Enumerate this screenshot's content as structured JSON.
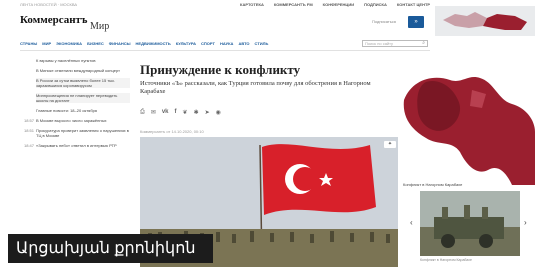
{
  "topbar": {
    "left_text": "ЛЕНТА НОВОСТЕЙ · МОСКВА",
    "links": [
      "КАРТОТЕКА",
      "КОММЕРСАНТЪ FM",
      "КОНФЕРЕНЦИИ",
      "ПОДПИСКА",
      "КОНТАКТ ЦЕНТР"
    ]
  },
  "brand": {
    "name": "Коммерсантъ",
    "section": "Мир"
  },
  "subscribe": {
    "label": "Подписаться",
    "button": "»"
  },
  "nav": {
    "items": [
      "СТРАНЫ",
      "МИР",
      "ЭКОНОМИКА",
      "БИЗНЕС",
      "ФИНАНСЫ",
      "НЕДВИЖИМОСТЬ",
      "КУЛЬТУРА",
      "СПОРТ",
      "НАУКА",
      "АВТО",
      "СТИЛЬ"
    ],
    "search_placeholder": "Поиск по сайту",
    "search_icon": "search-icon"
  },
  "sidebar": {
    "items": [
      {
        "time": "",
        "text": "К взрывы у населённых пунктов",
        "highlight": false
      },
      {
        "time": "",
        "text": "В Минске отменили международный концерт",
        "highlight": false
      },
      {
        "time": "",
        "text": "В России за сутки выявлено более 15 тыс. заразившихся коронавирусом",
        "highlight": true
      },
      {
        "time": "",
        "text": "Минпросвещения не планирует переводить школы на дистант",
        "highlight": true
      },
      {
        "time": "",
        "text": "Главные новости: 18–20 октября",
        "highlight": false
      },
      {
        "time": "18:57",
        "text": "В Москве выросло число заражённых",
        "highlight": false
      },
      {
        "time": "18:51",
        "text": "Прокуратура проверит заявления о нарушениях в ТЦ в Москве",
        "highlight": false
      },
      {
        "time": "18:47",
        "text": "«Закрывать небо» ответил в интервью РТР",
        "highlight": false
      }
    ]
  },
  "article": {
    "headline": "Принуждение к конфликту",
    "subhead": "Источники «Ъ» рассказали, как Турция готовила почву для обострения в Нагорном Карабахе",
    "share_icons": [
      "print-icon",
      "comments-icon",
      "vk-icon",
      "facebook-icon",
      "twitter-icon",
      "ok-icon",
      "telegram-icon",
      "whatsapp-icon"
    ],
    "meta": "Коммерсантъ от 14.10.2020, 00:10",
    "photo_badge": "✦"
  },
  "right_panel": {
    "map_caption": "Конфликт в Нагорном Карабахе",
    "photo_caption": "Конфликт в Нагорном Карабахе"
  },
  "overlay": {
    "text": "Արցախյան քրոնիկոն"
  },
  "colors": {
    "accent": "#1a5a9a",
    "map_red": "#9a1f2f",
    "flag_red": "#d8202a"
  }
}
